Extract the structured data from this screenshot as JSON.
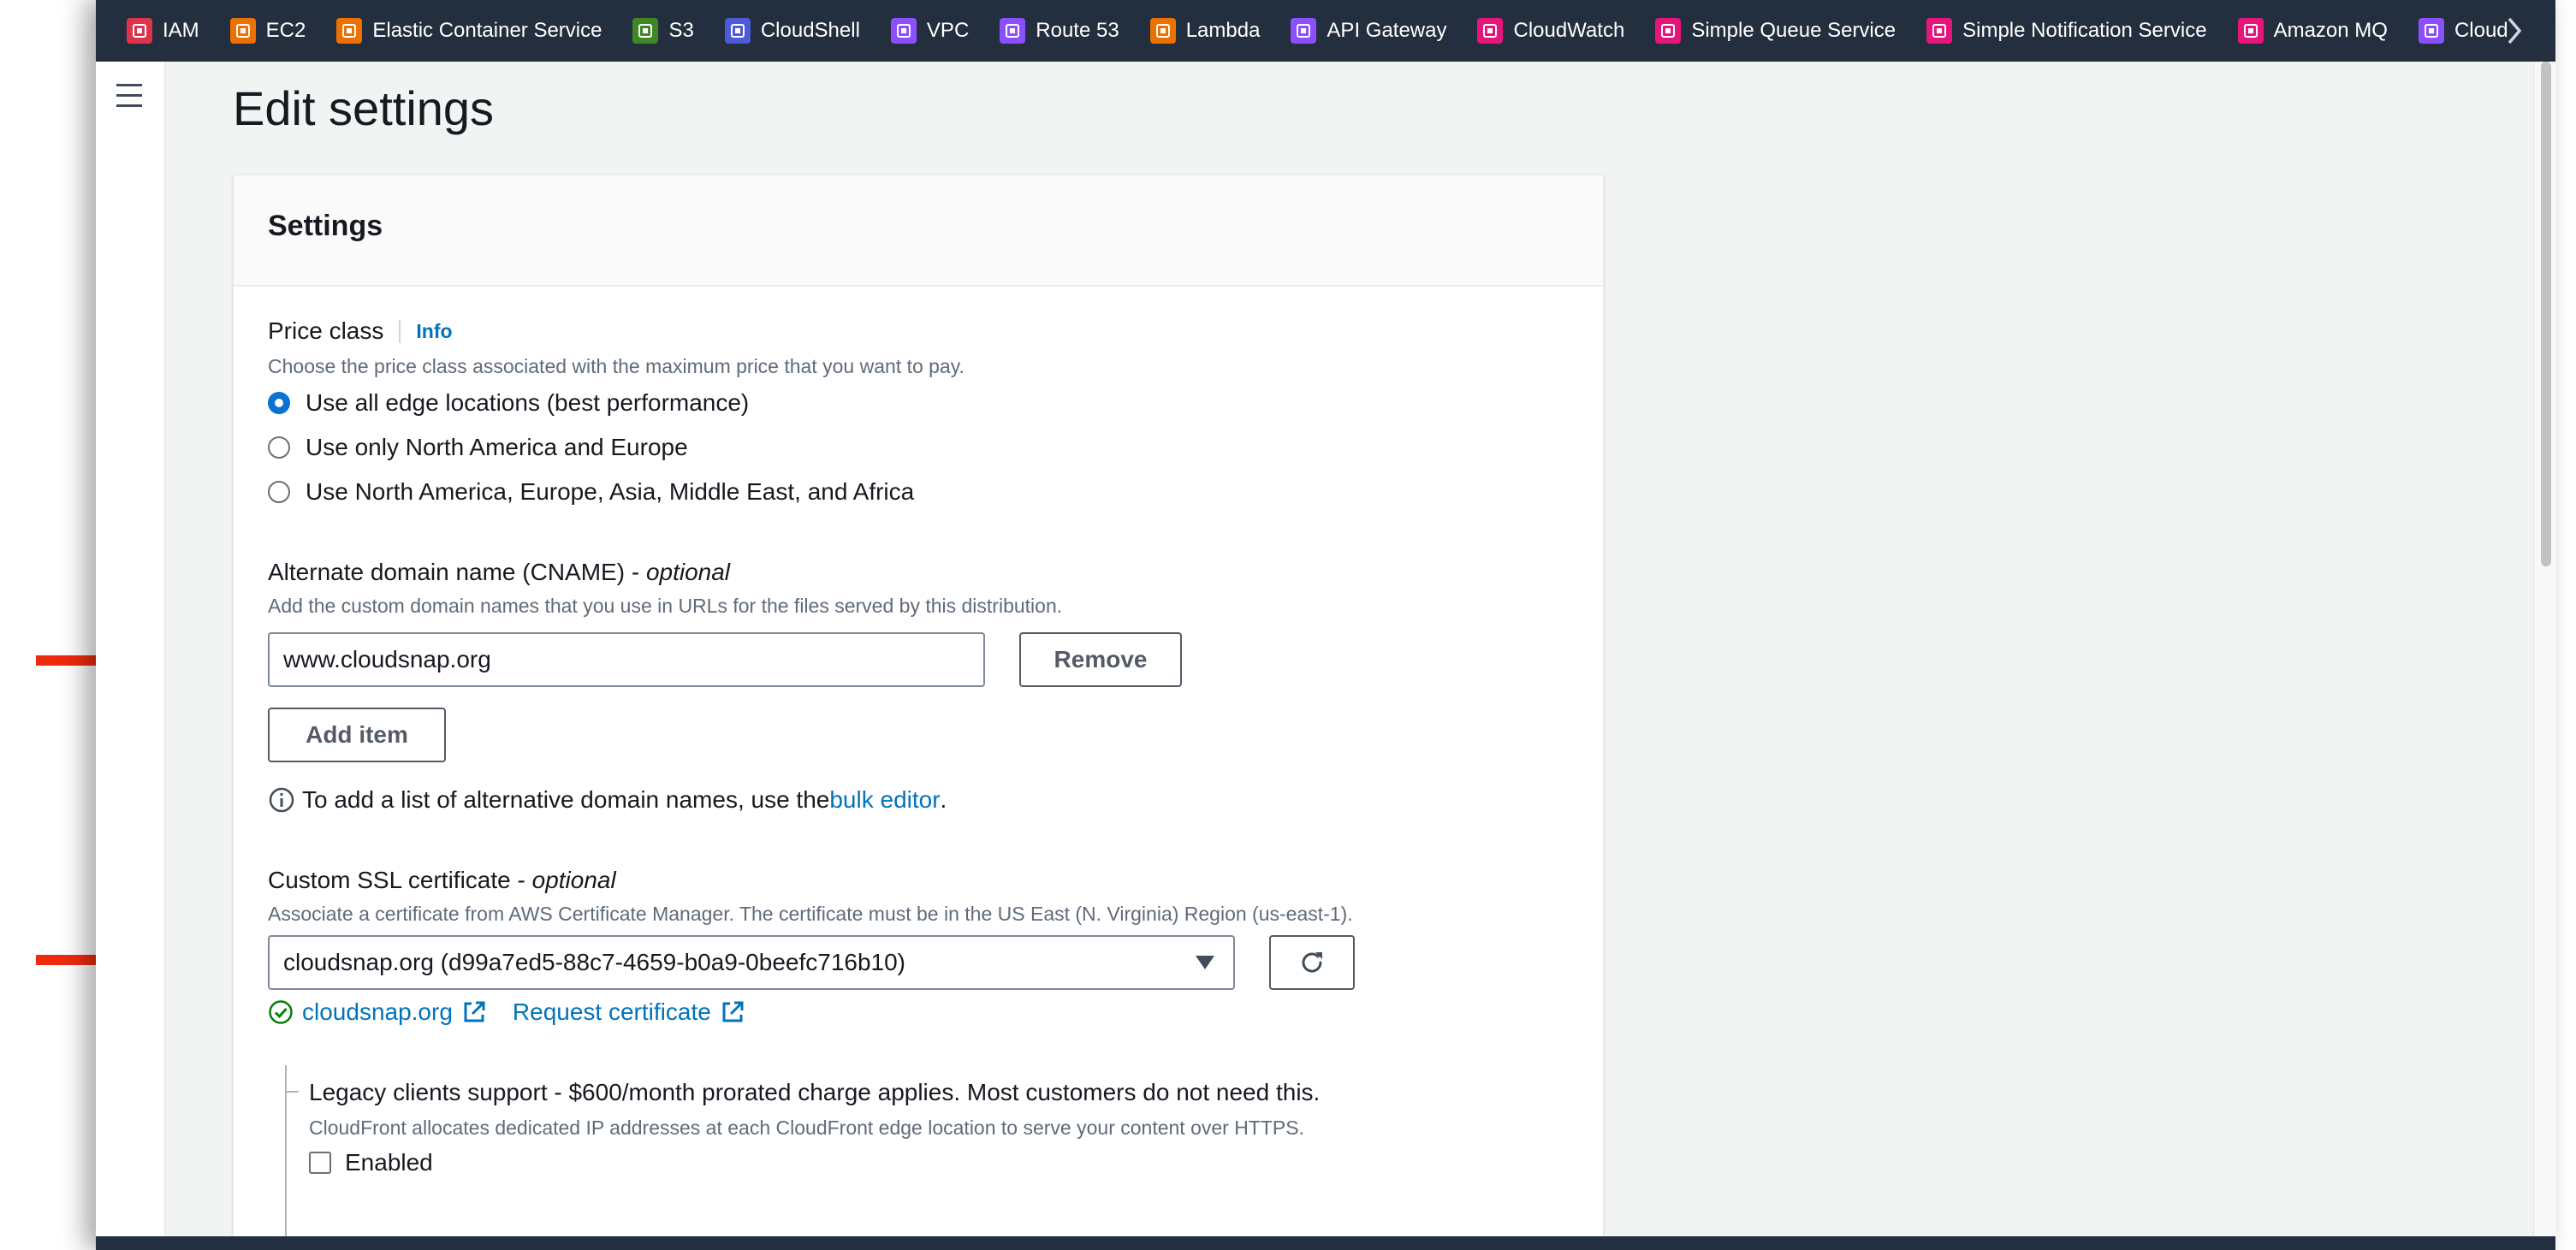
{
  "favorites": [
    {
      "label": "IAM",
      "color": "#dd344c",
      "icon": "iam-icon"
    },
    {
      "label": "EC2",
      "color": "#ed7100",
      "icon": "ec2-icon"
    },
    {
      "label": "Elastic Container Service",
      "color": "#ed7100",
      "icon": "ecs-icon"
    },
    {
      "label": "S3",
      "color": "#3f8624",
      "icon": "s3-icon"
    },
    {
      "label": "CloudShell",
      "color": "#4d5bd6",
      "icon": "cloudshell-icon"
    },
    {
      "label": "VPC",
      "color": "#8c4fff",
      "icon": "vpc-icon"
    },
    {
      "label": "Route 53",
      "color": "#8c4fff",
      "icon": "route53-icon"
    },
    {
      "label": "Lambda",
      "color": "#ed7100",
      "icon": "lambda-icon"
    },
    {
      "label": "API Gateway",
      "color": "#8c4fff",
      "icon": "api-gateway-icon"
    },
    {
      "label": "CloudWatch",
      "color": "#e7157b",
      "icon": "cloudwatch-icon"
    },
    {
      "label": "Simple Queue Service",
      "color": "#e7157b",
      "icon": "sqs-icon"
    },
    {
      "label": "Simple Notification Service",
      "color": "#e7157b",
      "icon": "sns-icon"
    },
    {
      "label": "Amazon MQ",
      "color": "#e7157b",
      "icon": "amazon-mq-icon"
    },
    {
      "label": "Cloud",
      "color": "#8c4fff",
      "icon": "cloudfront-icon"
    }
  ],
  "page": {
    "title": "Edit settings"
  },
  "settings": {
    "title": "Settings",
    "price_class": {
      "label": "Price class",
      "info": "Info",
      "description": "Choose the price class associated with the maximum price that you want to pay.",
      "options": [
        "Use all edge locations (best performance)",
        "Use only North America and Europe",
        "Use North America, Europe, Asia, Middle East, and Africa"
      ],
      "selected": 0
    },
    "cname": {
      "label": "Alternate domain name (CNAME) - ",
      "label_optional": "optional",
      "description": "Add the custom domain names that you use in URLs for the files served by this distribution.",
      "value": "www.cloudsnap.org",
      "remove_label": "Remove",
      "add_label": "Add item",
      "bulk_hint_prefix": "To add a list of alternative domain names, use the ",
      "bulk_link": "bulk editor",
      "bulk_hint_suffix": "."
    },
    "ssl": {
      "label": "Custom SSL certificate - ",
      "label_optional": "optional",
      "description": "Associate a certificate from AWS Certificate Manager. The certificate must be in the US East (N. Virginia) Region (us-east-1).",
      "selected": "cloudsnap.org (d99a7ed5-88c7-4659-b0a9-0beefc716b10)",
      "status_link": "cloudsnap.org",
      "request_link": "Request certificate"
    },
    "legacy": {
      "label": "Legacy clients support - $600/month prorated charge applies. Most customers do not need this.",
      "description": "CloudFront allocates dedicated IP addresses at each CloudFront edge location to serve your content over HTTPS.",
      "checkbox_label": "Enabled",
      "checked": false
    }
  },
  "colors": {
    "accent": "#0972d3",
    "link": "#0073bb",
    "success": "#037f0c",
    "annotation": "#ee2b0e",
    "nav_bg": "#232f3e"
  }
}
